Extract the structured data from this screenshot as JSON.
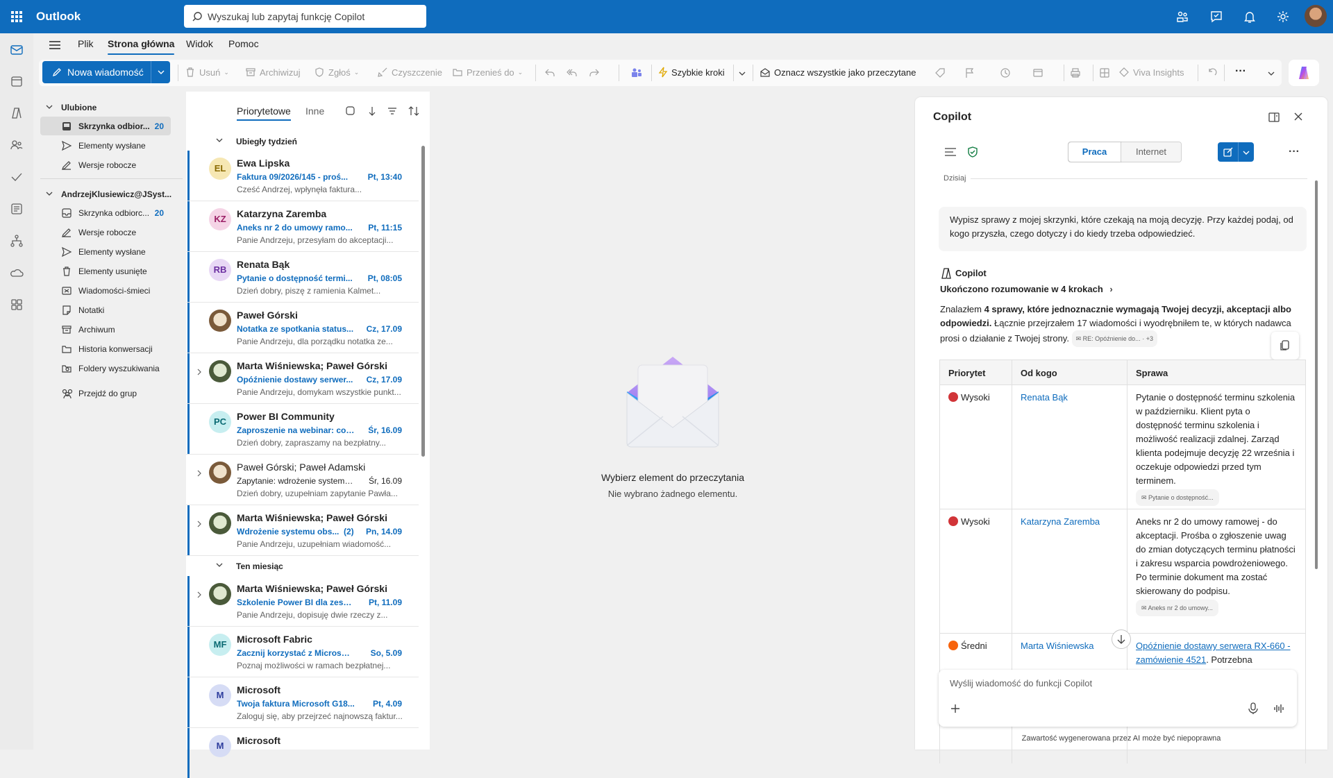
{
  "app": {
    "title": "Outlook"
  },
  "search": {
    "placeholder": "Wyszukaj lub zapytaj funkcję Copilot"
  },
  "tabs": [
    {
      "label": "Plik"
    },
    {
      "label": "Strona główna"
    },
    {
      "label": "Widok"
    },
    {
      "label": "Pomoc"
    }
  ],
  "ribbon": {
    "new_message": "Nowa wiadomość",
    "delete": "Usuń",
    "archive": "Archiwizuj",
    "report": "Zgłoś",
    "sweep": "Czyszczenie",
    "move": "Przenieś do",
    "quick_steps": "Szybkie kroki",
    "mark_all_read": "Oznacz wszystkie jako przeczytane",
    "viva": "Viva Insights"
  },
  "folders": {
    "favorites_label": "Ulubione",
    "favorites": [
      {
        "label": "Skrzynka odbior...",
        "count": "20"
      },
      {
        "label": "Elementy wysłane"
      },
      {
        "label": "Wersje robocze"
      }
    ],
    "account_label": "AndrzejKlusiewicz@JSyst...",
    "account": [
      {
        "label": "Skrzynka odbiorc...",
        "count": "20"
      },
      {
        "label": "Wersje robocze"
      },
      {
        "label": "Elementy wysłane"
      },
      {
        "label": "Elementy usunięte"
      },
      {
        "label": "Wiadomości-śmieci"
      },
      {
        "label": "Notatki"
      },
      {
        "label": "Archiwum"
      },
      {
        "label": "Historia konwersacji"
      },
      {
        "label": "Foldery wyszukiwania"
      }
    ],
    "groups": "Przejdź do grup"
  },
  "mail_list": {
    "tab_focused": "Priorytetowe",
    "tab_other": "Inne",
    "group_last_week": "Ubiegły tydzień",
    "group_this_month": "Ten miesiąc",
    "messages": [
      {
        "initials": "EL",
        "from": "Ewa Lipska",
        "subject": "Faktura 09/2026/145 - proś...",
        "date": "Pt, 13:40",
        "preview": "Cześć Andrzej, wpłynęła faktura..."
      },
      {
        "initials": "KZ",
        "from": "Katarzyna Zaremba",
        "subject": "Aneks nr 2 do umowy ramo...",
        "date": "Pt, 11:15",
        "preview": "Panie Andrzeju, przesyłam do akceptacji..."
      },
      {
        "initials": "RB",
        "from": "Renata Bąk",
        "subject": "Pytanie o dostępność termi...",
        "date": "Pt, 08:05",
        "preview": "Dzień dobry, piszę z ramienia Kalmet..."
      },
      {
        "initials": "",
        "from": "Paweł Górski",
        "subject": "Notatka ze spotkania status...",
        "date": "Cz, 17.09",
        "preview": "Panie Andrzeju, dla porządku notatka ze..."
      },
      {
        "initials": "",
        "from": "Marta Wiśniewska; Paweł Górski",
        "subject": "Opóźnienie dostawy serwer...",
        "date": "Cz, 17.09",
        "preview": "Panie Andrzeju, domykam wszystkie punkt..."
      },
      {
        "initials": "PC",
        "from": "Power BI Community",
        "subject": "Zaproszenie na webinar: co ...",
        "date": "Śr, 16.09",
        "preview": "Dzień dobry, zapraszamy na bezpłatny..."
      },
      {
        "initials": "",
        "from": "Paweł Górski; Paweł Adamski",
        "subject": "Zapytanie: wdrożenie systemu ...",
        "date": "Śr, 16.09",
        "preview": "Dzień dobry, uzupełniam zapytanie Pawła..."
      },
      {
        "initials": "",
        "from": "Marta Wiśniewska; Paweł Górski",
        "subject": "Wdrożenie systemu obs...",
        "count": "(2)",
        "date": "Pn, 14.09",
        "preview": "Panie Andrzeju, uzupełniam wiadomość..."
      },
      {
        "initials": "",
        "from": "Marta Wiśniewska; Paweł Górski",
        "subject": "Szkolenie Power BI dla zesp...",
        "date": "Pt, 11.09",
        "preview": "Panie Andrzeju, dopisuję dwie rzeczy z..."
      },
      {
        "initials": "MF",
        "from": "Microsoft Fabric",
        "subject": "Zacznij korzystać z Microsoft...",
        "date": "So, 5.09",
        "preview": "Poznaj możliwości w ramach bezpłatnej..."
      },
      {
        "initials": "M",
        "from": "Microsoft",
        "subject": "Twoja faktura Microsoft G18...",
        "date": "Pt, 4.09",
        "preview": "Zaloguj się, aby przejrzeć najnowszą faktur..."
      },
      {
        "initials": "M",
        "from": "Microsoft",
        "subject": "",
        "date": "",
        "preview": ""
      }
    ]
  },
  "reading_pane": {
    "title": "Wybierz element do przeczytania",
    "subtitle": "Nie wybrano żadnego elementu."
  },
  "copilot": {
    "title": "Copilot",
    "toggle_work": "Praca",
    "toggle_web": "Internet",
    "today": "Dzisiaj",
    "prompt": "Wypisz sprawy z mojej skrzynki, które czekają na moją decyzję. Przy każdej podaj, od kogo przyszła, czego dotyczy i do kiedy trzeba odpowiedzieć.",
    "name": "Copilot",
    "reasoning": "Ukończono rozumowanie w 4 krokach",
    "answer_a": "Znalazłem ",
    "answer_b": "4 sprawy, które jednoznacznie wymagają Twojej decyzji, akceptacji albo odpowiedzi.",
    "answer_c": " Łącznie przejrzałem 17 wiadomości i wyodrębniłem te, w których nadawca prosi o działanie z Twojej strony.",
    "answer_chip": "RE: Opóźnienie do...",
    "answer_chip_more": "+3",
    "table": {
      "headers": [
        "Priorytet",
        "Od kogo",
        "Sprawa"
      ],
      "rows": [
        {
          "priority": "Wysoki",
          "from": "Renata Bąk",
          "issue": "Pytanie o dostępność terminu szkolenia w październiku. Klient pyta o dostępność terminu szkolenia i możliwość realizacji zdalnej. Zarząd klienta podejmuje decyzję 22 września i oczekuje odpowiedzi przed tym terminem.",
          "chip": "Pytanie o dostępność..."
        },
        {
          "priority": "Wysoki",
          "from": "Katarzyna Zaremba",
          "issue": "Aneks nr 2 do umowy ramowej - do akceptacji. Prośba o zgłoszenie uwag do zmian dotyczących terminu płatności i zakresu wsparcia powdrożeniowego. Po terminie dokument ma zostać skierowany do podpisu.",
          "chip": "Aneks nr 2 do umowy..."
        },
        {
          "priority": "Średni",
          "from": "Marta Wiśniewska",
          "issue_link": "Opóźnienie dostawy serwera RX-660 - zamówienie 4521",
          "issue_tail": ". Potrzebna"
        }
      ]
    },
    "composer_placeholder": "Wyślij wiadomość do funkcji Copilot",
    "disclaimer": "Zawartość wygenerowana przez AI może być niepoprawna"
  },
  "colors": {
    "accent": "#0f6cbd",
    "high": "#d13438",
    "medium": "#f7630c"
  }
}
